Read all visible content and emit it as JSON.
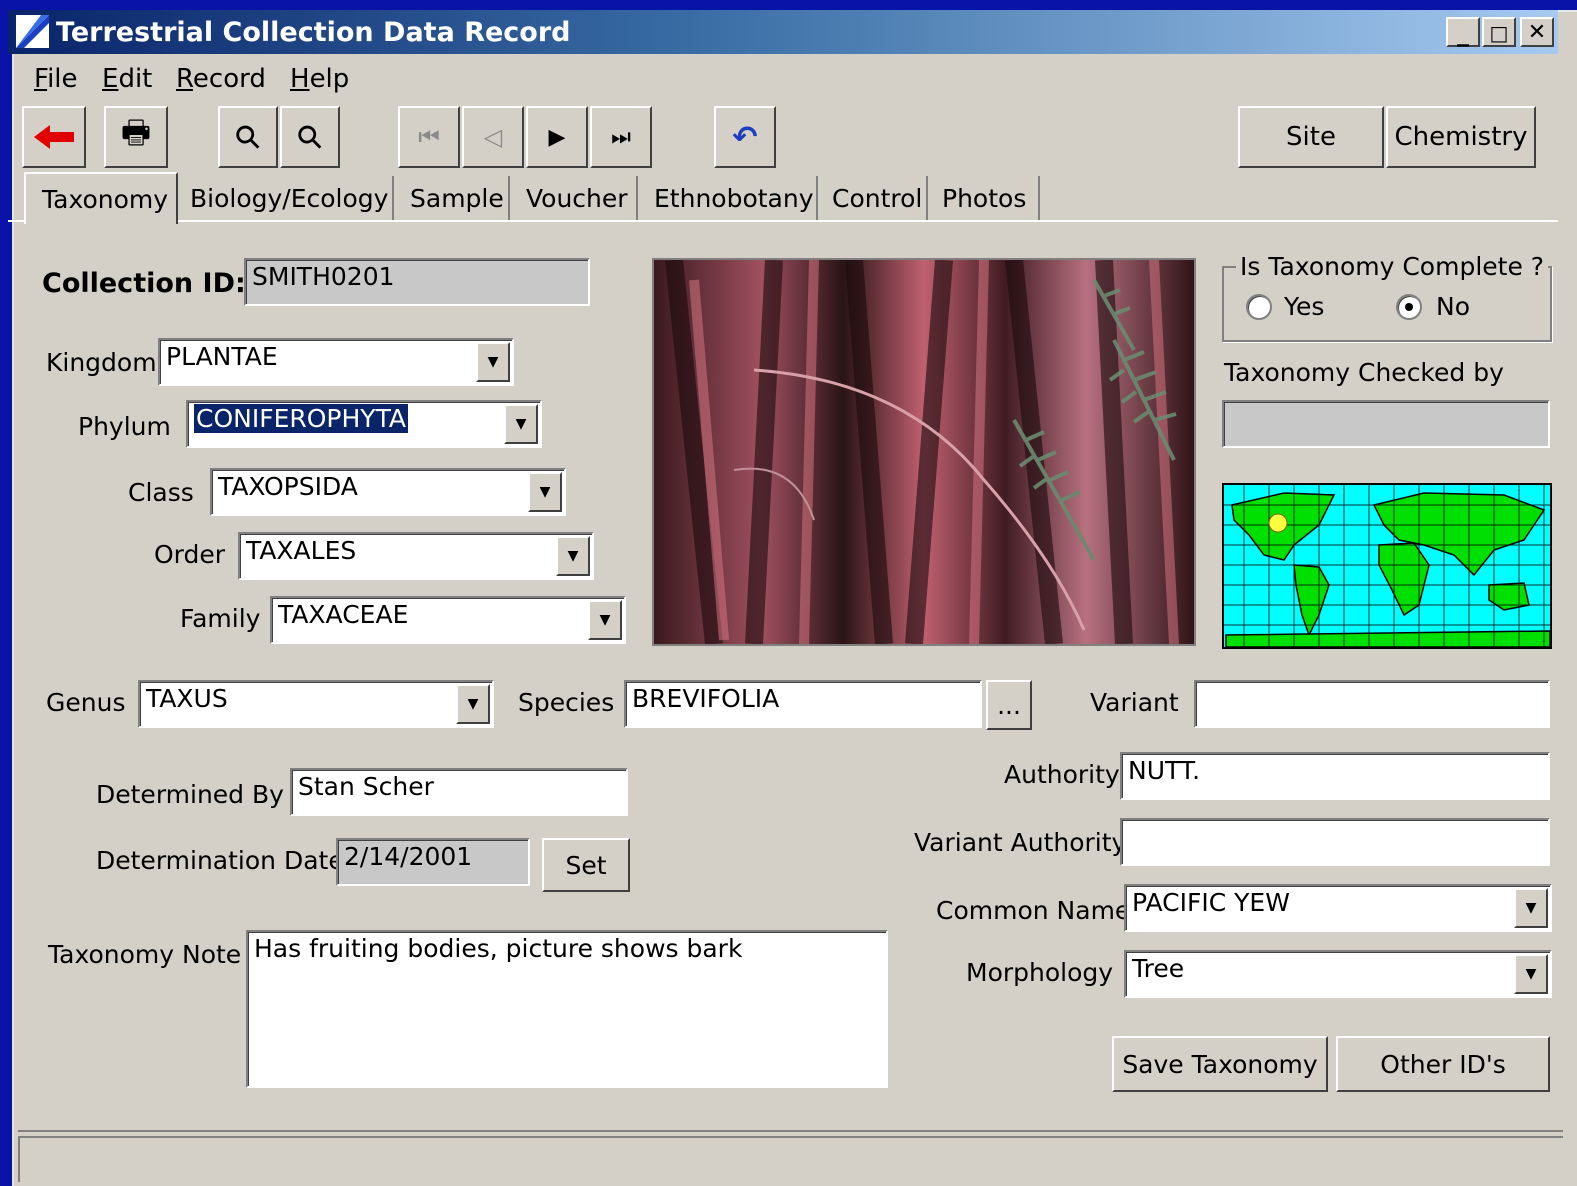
{
  "window": {
    "title": "Terrestrial Collection Data Record",
    "caption_buttons": {
      "minimize": "_",
      "maximize": "□",
      "close": "✕"
    }
  },
  "menu": {
    "items": [
      "File",
      "Edit",
      "Record",
      "Help"
    ]
  },
  "toolbar": {
    "icons": [
      "back-arrow-icon",
      "print-icon",
      "find-icon",
      "find-next-icon",
      "first-record-icon",
      "previous-record-icon",
      "next-record-icon",
      "last-record-icon",
      "undo-icon"
    ],
    "glyphs": {
      "back": "🡸",
      "print": "🖶",
      "find": "⚲",
      "find_next": "⚲",
      "first": "⏮",
      "prev": "◁",
      "next": "▶",
      "last": "⏭",
      "undo": "↶"
    },
    "site_label": "Site",
    "chemistry_label": "Chemistry"
  },
  "tabs": [
    "Taxonomy",
    "Biology/Ecology",
    "Sample",
    "Voucher",
    "Ethnobotany",
    "Control",
    "Photos"
  ],
  "form": {
    "collection_id": {
      "label": "Collection ID:",
      "value": "SMITH0201"
    },
    "kingdom": {
      "label": "Kingdom",
      "value": "PLANTAE"
    },
    "phylum": {
      "label": "Phylum",
      "value": "CONIFEROPHYTA"
    },
    "class": {
      "label": "Class",
      "value": "TAXOPSIDA"
    },
    "order": {
      "label": "Order",
      "value": "TAXALES"
    },
    "family": {
      "label": "Family",
      "value": "TAXACEAE"
    },
    "genus": {
      "label": "Genus",
      "value": "TAXUS"
    },
    "species": {
      "label": "Species",
      "value": "BREVIFOLIA",
      "button_label": "..."
    },
    "variant": {
      "label": "Variant",
      "value": ""
    },
    "determined_by": {
      "label": "Determined By",
      "value": "Stan Scher"
    },
    "determination_date": {
      "label": "Determination Date",
      "value": "2/14/2001",
      "set_label": "Set"
    },
    "taxonomy_note": {
      "label": "Taxonomy Note",
      "value": "Has fruiting bodies, picture shows bark"
    },
    "authority": {
      "label": "Authority",
      "value": "NUTT."
    },
    "variant_authority": {
      "label": "Variant Authority",
      "value": ""
    },
    "common_name": {
      "label": "Common Name",
      "value": "PACIFIC YEW"
    },
    "morphology": {
      "label": "Morphology",
      "value": "Tree"
    },
    "taxonomy_complete": {
      "label": "Is Taxonomy Complete ?",
      "options": [
        "Yes",
        "No"
      ],
      "selected": "No"
    },
    "checked_by": {
      "label": "Taxonomy Checked by",
      "value": ""
    },
    "save_label": "Save Taxonomy",
    "other_ids_label": "Other ID's"
  },
  "colors": {
    "title_bar_start": "#0a246a",
    "title_bar_end": "#a6caf0",
    "face": "#d4d0c8",
    "desktop": "#0a13a8",
    "map_ocean": "#00ffff",
    "map_land": "#00e000"
  }
}
